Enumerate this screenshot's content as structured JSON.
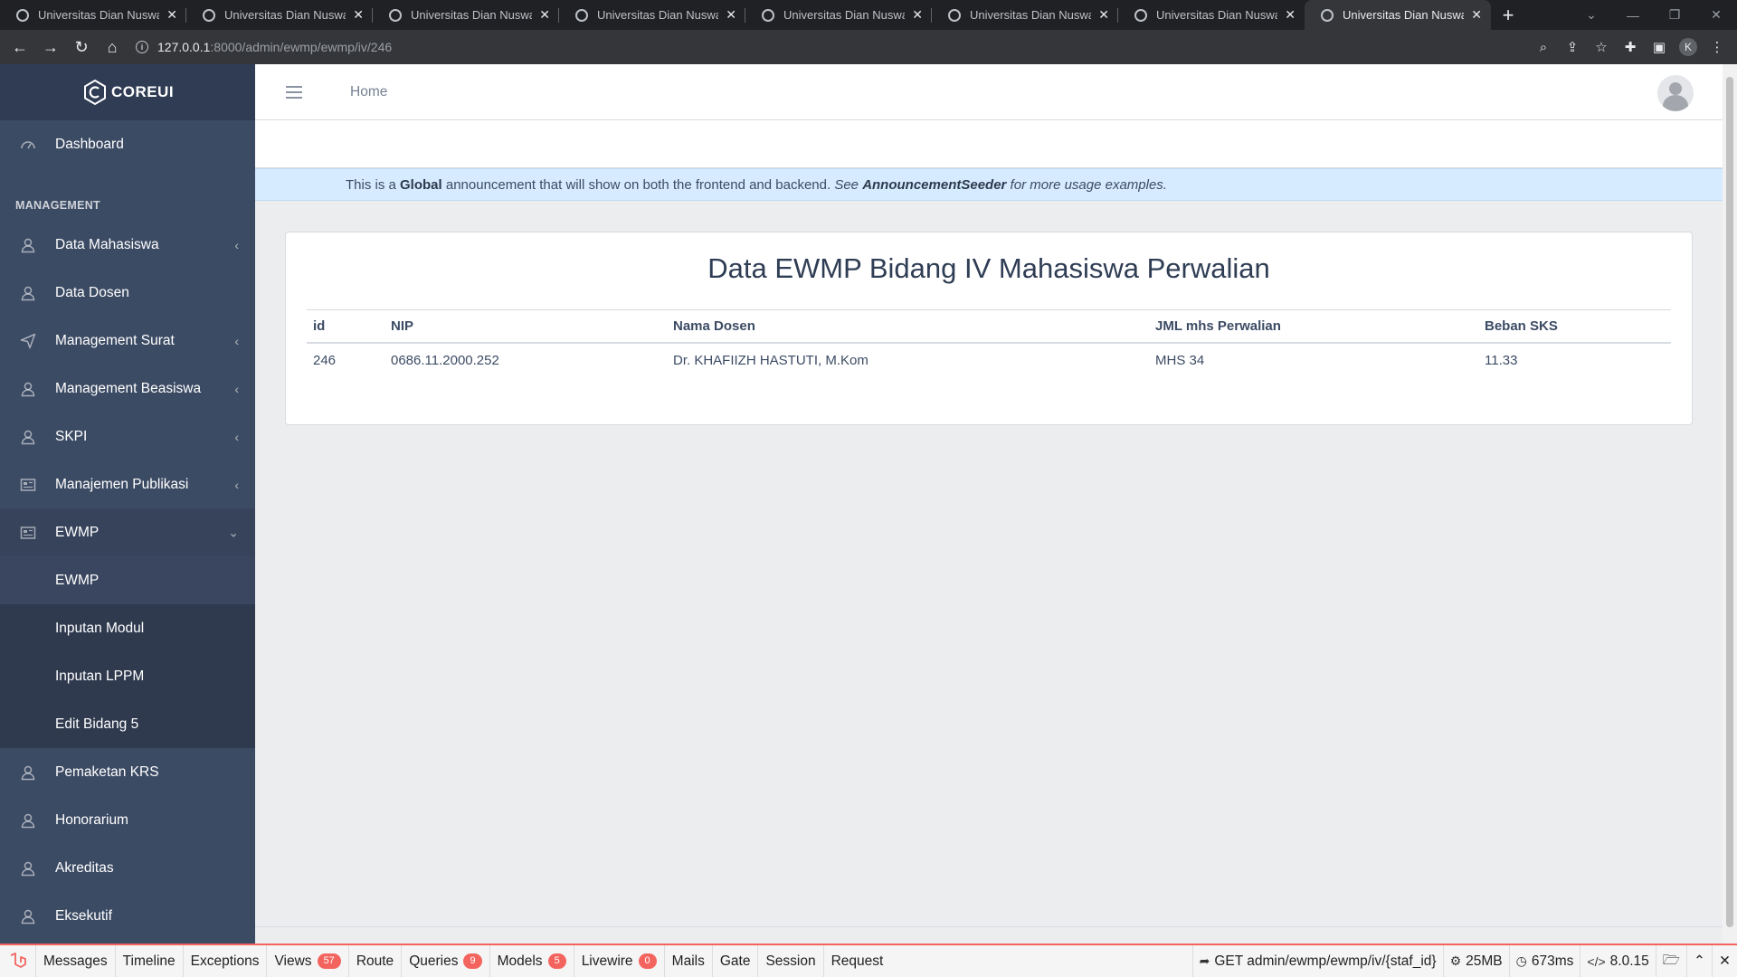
{
  "browser": {
    "tabs": [
      {
        "title": "Universitas Dian Nuswanto"
      },
      {
        "title": "Universitas Dian Nuswanto"
      },
      {
        "title": "Universitas Dian Nuswanto"
      },
      {
        "title": "Universitas Dian Nuswanto"
      },
      {
        "title": "Universitas Dian Nuswanto"
      },
      {
        "title": "Universitas Dian Nuswanto"
      },
      {
        "title": "Universitas Dian Nuswanto"
      },
      {
        "title": "Universitas Dian Nuswanto"
      }
    ],
    "url_host": "127.0.0.1",
    "url_path": ":8000/admin/ewmp/ewmp/iv/246",
    "profile_initial": "K"
  },
  "sidebar": {
    "brand": "COREUI",
    "dashboard": "Dashboard",
    "section_title": "MANAGEMENT",
    "items": [
      {
        "label": "Data Mahasiswa"
      },
      {
        "label": "Data Dosen"
      },
      {
        "label": "Management Surat"
      },
      {
        "label": "Management Beasiswa"
      },
      {
        "label": "SKPI"
      },
      {
        "label": "Manajemen Publikasi"
      },
      {
        "label": "EWMP"
      }
    ],
    "ewmp_children": [
      {
        "label": "EWMP"
      },
      {
        "label": "Inputan Modul"
      },
      {
        "label": "Inputan LPPM"
      },
      {
        "label": "Edit Bidang 5"
      }
    ],
    "items_after": [
      {
        "label": "Pemaketan KRS"
      },
      {
        "label": "Honorarium"
      },
      {
        "label": "Akreditas"
      },
      {
        "label": "Eksekutif"
      }
    ]
  },
  "header": {
    "home": "Home"
  },
  "announcement": {
    "p1": "This is a ",
    "global": "Global",
    "p2": " announcement that will show on both the frontend and backend. ",
    "see": "See ",
    "seeder": "AnnouncementSeeder",
    "p3": " for more usage examples."
  },
  "main": {
    "title": "Data EWMP Bidang IV Mahasiswa Perwalian",
    "columns": [
      "id",
      "NIP",
      "Nama Dosen",
      "JML mhs Perwalian",
      "Beban SKS"
    ],
    "rows": [
      [
        "246",
        "0686.11.2000.252",
        "Dr. KHAFIIZH HASTUTI, M.Kom",
        "MHS 34",
        "11.33"
      ]
    ]
  },
  "debugbar": {
    "tabs": [
      {
        "label": "Messages",
        "badge": ""
      },
      {
        "label": "Timeline",
        "badge": ""
      },
      {
        "label": "Exceptions",
        "badge": ""
      },
      {
        "label": "Views",
        "badge": "57"
      },
      {
        "label": "Route",
        "badge": ""
      },
      {
        "label": "Queries",
        "badge": "9"
      },
      {
        "label": "Models",
        "badge": "5"
      },
      {
        "label": "Livewire",
        "badge": "0"
      },
      {
        "label": "Mails",
        "badge": ""
      },
      {
        "label": "Gate",
        "badge": ""
      },
      {
        "label": "Session",
        "badge": ""
      },
      {
        "label": "Request",
        "badge": ""
      }
    ],
    "route": "GET admin/ewmp/ewmp/iv/{staf_id}",
    "memory": "25MB",
    "time": "673ms",
    "php": "8.0.15"
  },
  "colors": {
    "sidebar_bg": "#3c4b64",
    "brand_bg": "#303c54",
    "announcement_bg": "#d6ebff",
    "debugbar_accent": "#f4645f"
  }
}
